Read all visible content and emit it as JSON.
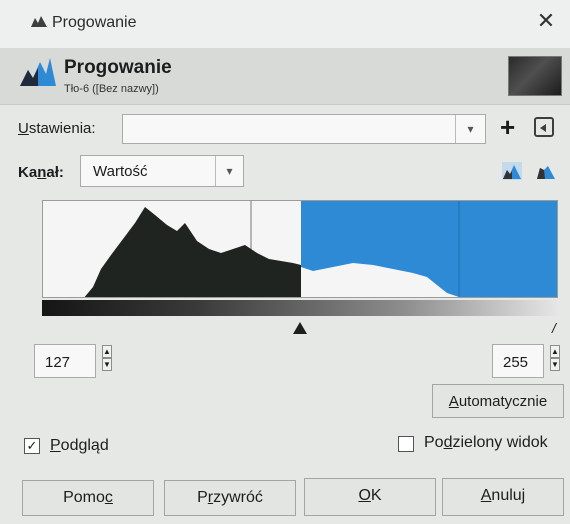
{
  "window": {
    "title": "Progowanie"
  },
  "header": {
    "title": "Progowanie",
    "subtitle": "Tło-6 ([Bez nazwy])"
  },
  "settings": {
    "label_u": "U",
    "label_rest": "stawienia:",
    "value": "",
    "add_symbol": "+"
  },
  "channel": {
    "label_pre": "Ka",
    "label_u": "n",
    "label_post": "ał:",
    "value": "Wartość"
  },
  "levels": {
    "low": "127",
    "high": "255"
  },
  "buttons": {
    "auto_u": "A",
    "auto_rest": "utomatycznie",
    "help_pre": "Pomo",
    "help_u": "c",
    "reset_pre": "P",
    "reset_u": "r",
    "reset_post": "zywróć",
    "ok_u": "O",
    "ok_post": "K",
    "cancel_u": "A",
    "cancel_post": "nuluj"
  },
  "options": {
    "preview_u": "P",
    "preview_rest": "odgląd",
    "preview_checked": true,
    "split_pre": "Po",
    "split_u": "d",
    "split_post": "zielony widok",
    "split_checked": false
  },
  "colors": {
    "accent": "#2f8ad6",
    "histogram_dark": "#202421"
  }
}
